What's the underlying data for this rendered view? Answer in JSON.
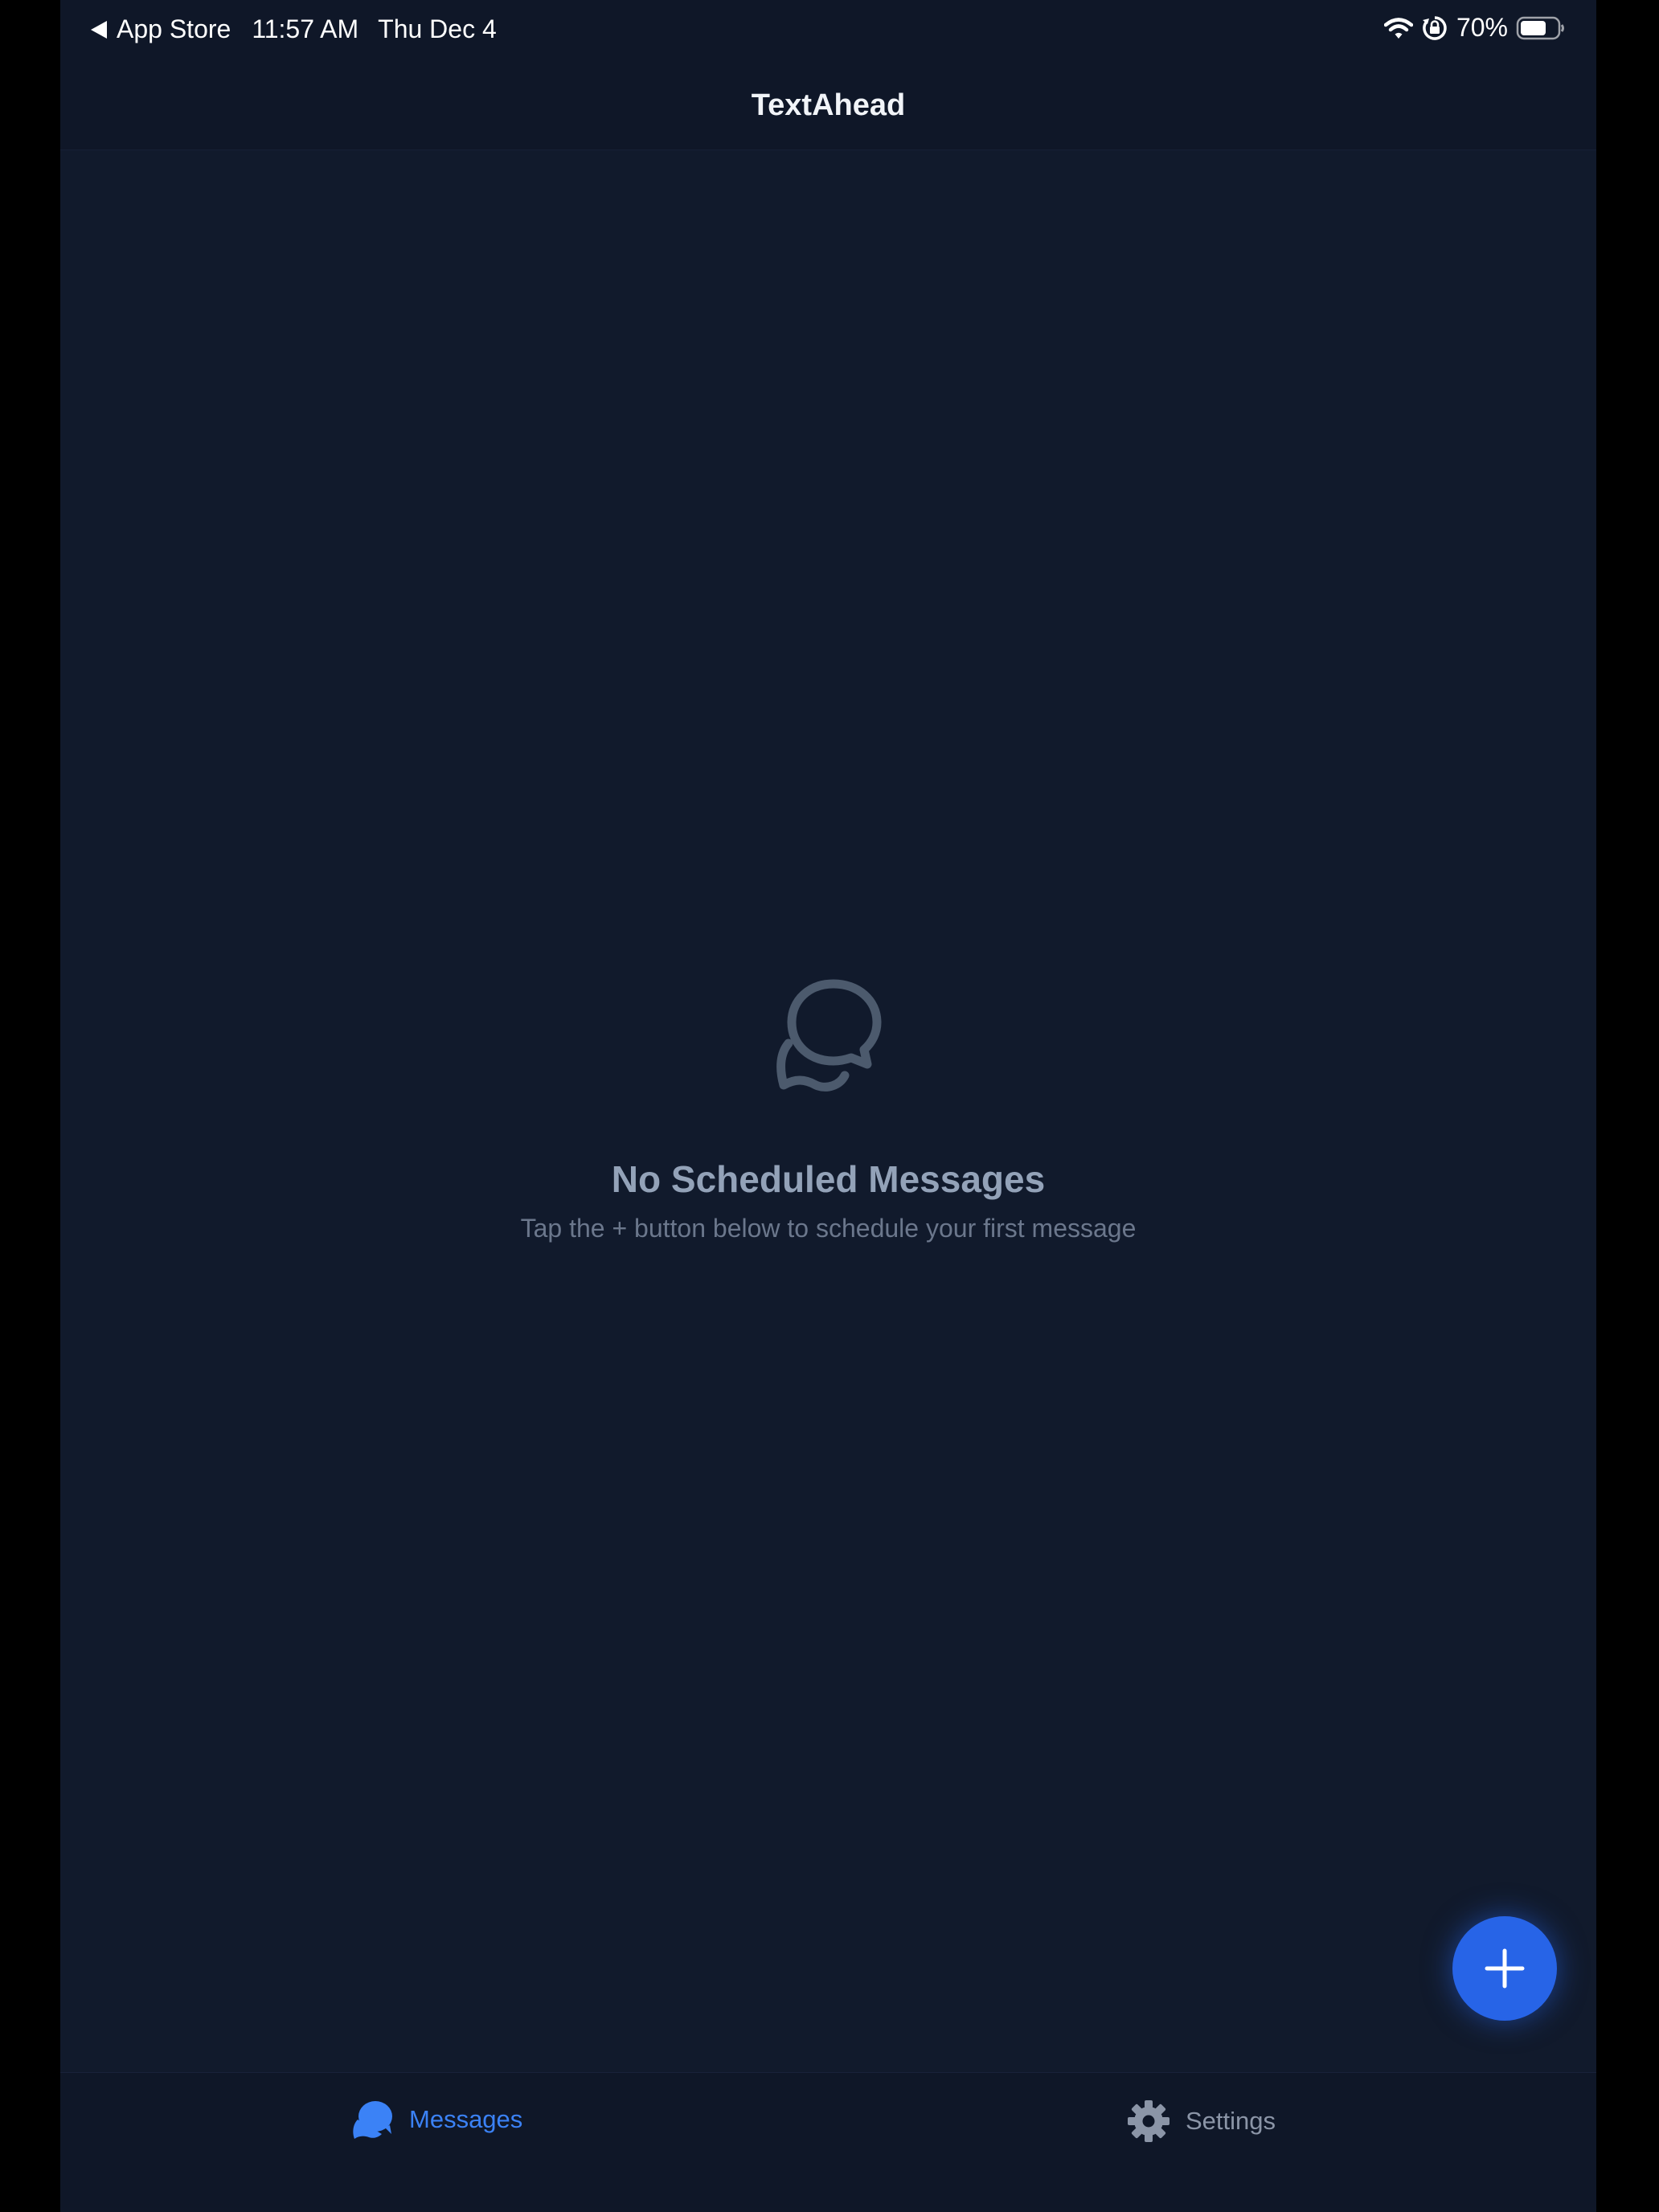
{
  "status_bar": {
    "back_label": "App Store",
    "time": "11:57 AM",
    "date": "Thu Dec 4",
    "battery_percent": "70%",
    "battery_level": 0.7,
    "icons": [
      "wifi-icon",
      "orientation-lock-icon",
      "battery-icon"
    ]
  },
  "header": {
    "title": "TextAhead"
  },
  "empty_state": {
    "icon": "chat-bubbles-icon",
    "title": "No Scheduled Messages",
    "subtitle": "Tap the + button below to schedule your first message"
  },
  "fab": {
    "icon": "plus-icon"
  },
  "tab_bar": {
    "tabs": [
      {
        "label": "Messages",
        "icon": "chat-bubbles-icon",
        "active": true
      },
      {
        "label": "Settings",
        "icon": "gear-icon",
        "active": false
      }
    ]
  },
  "colors": {
    "background": "#111a2c",
    "bar_background": "#0f1728",
    "accent": "#2764e7",
    "active_tab": "#3b82f6",
    "inactive_tab": "#8b95a7",
    "empty_title": "#93a2b8",
    "empty_subtitle": "#6b778c"
  }
}
